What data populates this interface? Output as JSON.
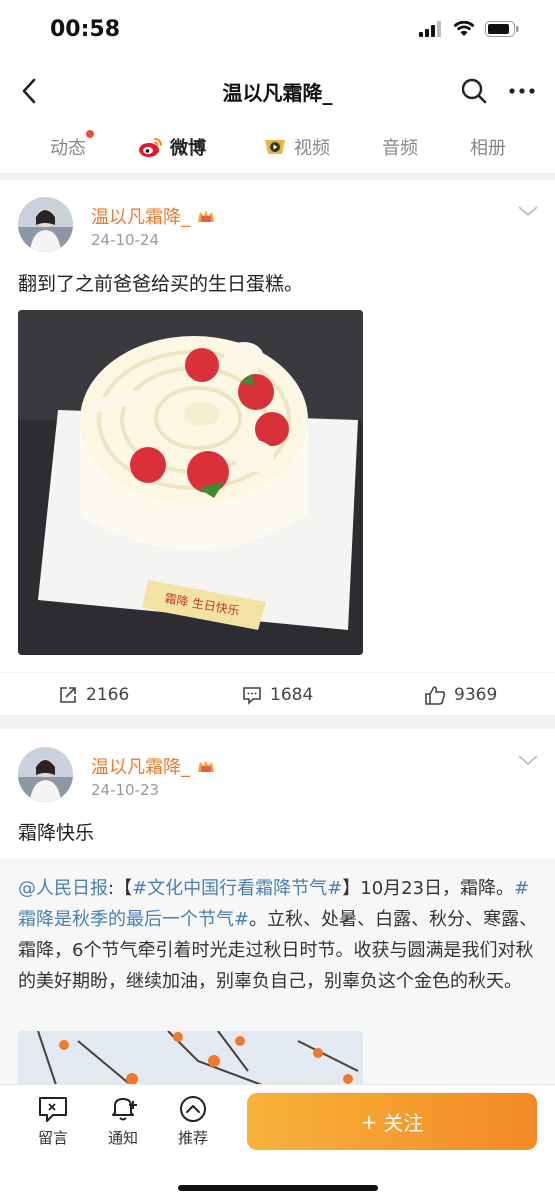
{
  "status_bar": {
    "time": "00:58"
  },
  "nav": {
    "title": "温以凡霜降_"
  },
  "tabs": [
    {
      "label": "动态",
      "has_dot": true
    },
    {
      "label": "微博",
      "active": true
    },
    {
      "label": "视频"
    },
    {
      "label": "音频"
    },
    {
      "label": "相册"
    }
  ],
  "posts": [
    {
      "username": "温以凡霜降_",
      "date": "24-10-24",
      "text": "翻到了之前爸爸给买的生日蛋糕。",
      "image_caption": "霜降 生日快乐",
      "reposts": "2166",
      "comments": "1684",
      "likes": "9369"
    },
    {
      "username": "温以凡霜降_",
      "date": "24-10-23",
      "text": "霜降快乐",
      "retweet": {
        "mention": "@人民日报",
        "colon": ":【",
        "topic1": "#文化中国行看霜降节气#",
        "part1": "】10月23日，霜降。",
        "topic2": "#霜降是秋季的最后一个节气#",
        "part2": "。立秋、处暑、白露、秋分、寒露、霜降，6个节气牵引着时光走过秋日时节。收获与圆满是我们对秋的美好期盼，继续加油，别辜负自己，别辜负这个金色的秋天。"
      }
    }
  ],
  "bottom_bar": {
    "message_label": "留言",
    "notify_label": "通知",
    "recommend_label": "推荐",
    "follow_label": "关注",
    "follow_plus": "+"
  },
  "colors": {
    "accent": "#f48a24",
    "username": "#f07a2a",
    "link": "#4a7fb5"
  }
}
